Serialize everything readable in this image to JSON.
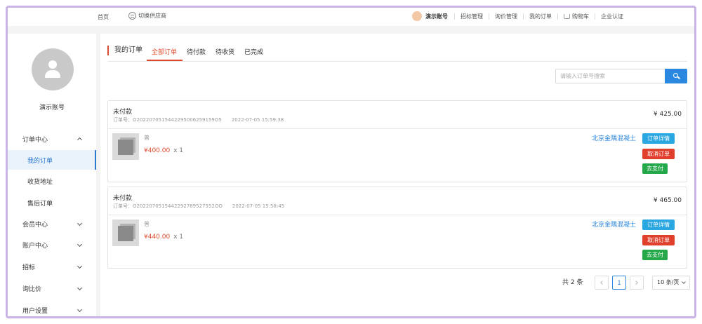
{
  "topbar": {
    "home": "首页",
    "switch_supplier": "切换供应商",
    "username": "演示账号",
    "links": [
      "招标管理",
      "询价管理",
      "我的订单",
      "购物车",
      "企业认证"
    ]
  },
  "sidebar": {
    "name": "演示账号",
    "menu": [
      {
        "label": "订单中心"
      },
      {
        "label": "我的订单"
      },
      {
        "label": "收货地址"
      },
      {
        "label": "售后订单"
      },
      {
        "label": "会员中心"
      },
      {
        "label": "账户中心"
      },
      {
        "label": "招标"
      },
      {
        "label": "询比价"
      },
      {
        "label": "用户设置"
      }
    ]
  },
  "tabs": {
    "title": "我的订单",
    "items": [
      "全部订单",
      "待付款",
      "待收货",
      "已完成"
    ]
  },
  "search": {
    "placeholder": "请输入订单号搜索"
  },
  "orders": [
    {
      "status": "未付款",
      "order_no": "订单号：O2022070515442295006259159O5",
      "time": "2022-07-05 15:59:38",
      "total": "¥ 425.00",
      "product": "普",
      "price": "¥400.00",
      "qty": "x 1",
      "seller": "北京金隅混凝土",
      "btn_detail": "订单详情",
      "btn_cancel": "取消订单",
      "btn_pay": "去支付"
    },
    {
      "status": "未付款",
      "order_no": "订单号：O2022070515442292789527552OO",
      "time": "2022-07-05 15:58:45",
      "total": "¥ 465.00",
      "product": "普",
      "price": "¥440.00",
      "qty": "x 1",
      "seller": "北京金隅混凝土",
      "btn_detail": "订单详情",
      "btn_cancel": "取消订单",
      "btn_pay": "去支付"
    }
  ],
  "pager": {
    "total": "共 2 条",
    "current": "1",
    "page_size": "10 条/页"
  }
}
